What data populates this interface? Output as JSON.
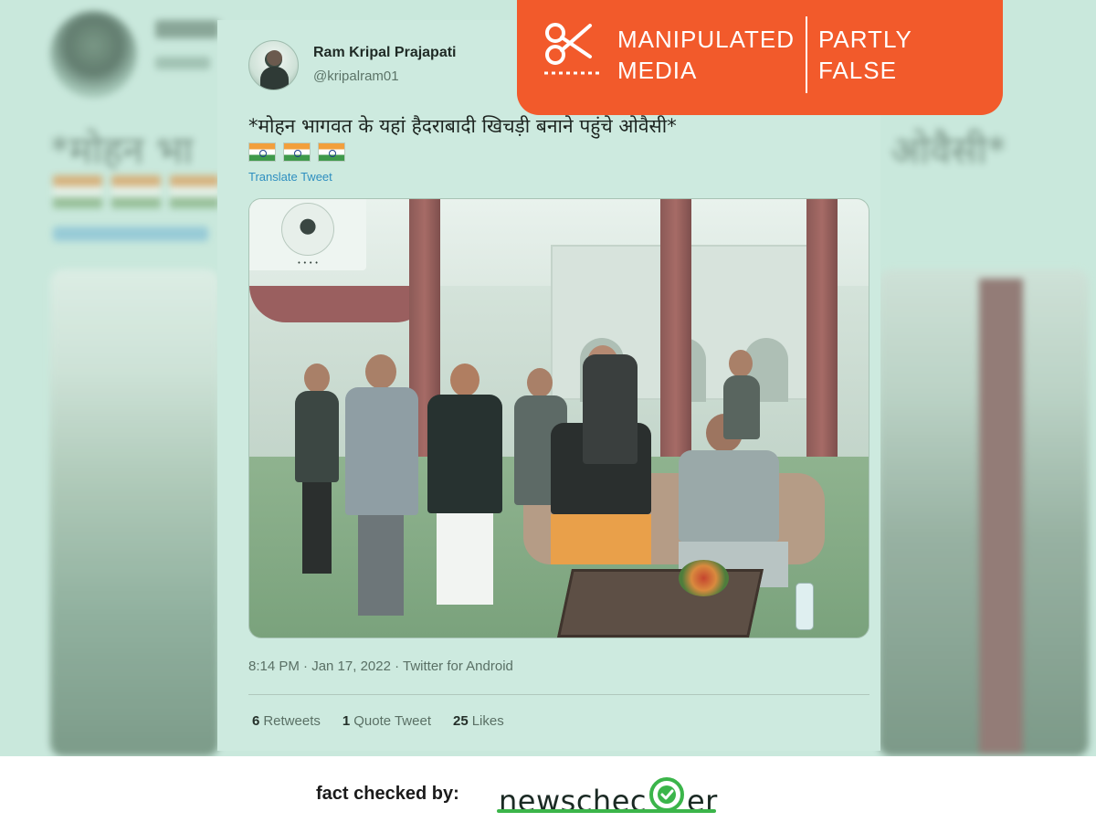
{
  "tweet": {
    "author_name": "Ram Kripal Prajapati",
    "author_handle": "@kripalram01",
    "text": "*मोहन भागवत के यहां हैदराबादी खिचड़ी बनाने पहुंचे ओवैसी*",
    "flags": [
      "indian-flag-emoji",
      "indian-flag-emoji",
      "indian-flag-emoji"
    ],
    "translate_label": "Translate Tweet",
    "timestamp": "8:14 PM · Jan 17, 2022 · Twitter for Android",
    "stats": [
      {
        "count": "6",
        "label": "Retweets"
      },
      {
        "count": "1",
        "label": "Quote Tweet"
      },
      {
        "count": "25",
        "label": "Likes"
      }
    ]
  },
  "background": {
    "hindi_left": "*मोहन भा",
    "hindi_right": "ओवैसी*"
  },
  "badge": {
    "icon": "scissors-icon",
    "label_line1": "MANIPULATED",
    "label_line2": "MEDIA",
    "verdict_line1": "PARTLY",
    "verdict_line2": "FALSE",
    "color": "#f25a2b"
  },
  "footer": {
    "fact_checked_label": "fact checked by:",
    "brand_prefix": "newschec",
    "brand_suffix": "er",
    "brand_icon": "checkmark-circle-icon",
    "brand_color": "#3bb54a"
  },
  "colors": {
    "tint": "#c9e8dc",
    "link": "#2f8fc0"
  }
}
